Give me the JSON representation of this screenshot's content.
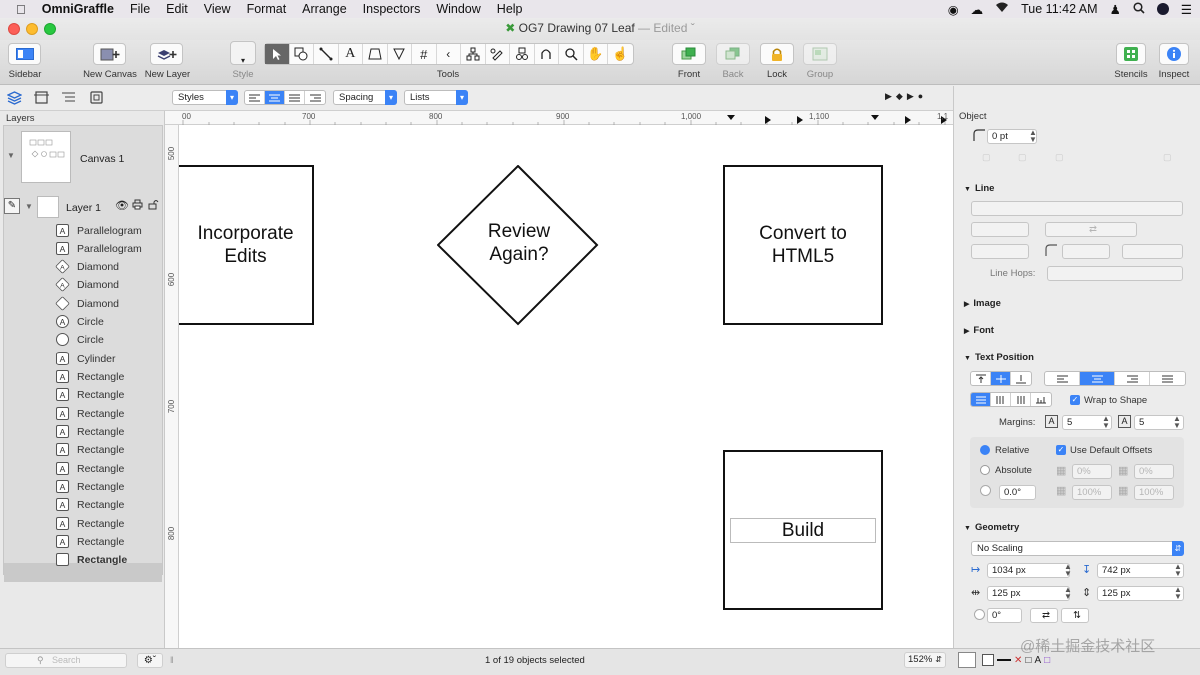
{
  "menubar": {
    "app_name": "OmniGraffle",
    "items": [
      "File",
      "Edit",
      "View",
      "Format",
      "Arrange",
      "Inspectors",
      "Window",
      "Help"
    ],
    "clock": "Tue 11:42 AM"
  },
  "window": {
    "title": "OG7 Drawing 07 Leaf",
    "edited": "— Edited"
  },
  "toolbar": {
    "sidebar": "Sidebar",
    "new_canvas": "New Canvas",
    "new_layer": "New Layer",
    "style": "Style",
    "tools": "Tools",
    "front": "Front",
    "back": "Back",
    "lock": "Lock",
    "group": "Group",
    "stencils": "Stencils",
    "inspect": "Inspect"
  },
  "subbar": {
    "styles": "Styles",
    "spacing": "Spacing",
    "lists": "Lists"
  },
  "sidebar": {
    "layers_header": "Layers",
    "canvas_name": "Canvas 1",
    "layer_name": "Layer 1",
    "items": [
      {
        "label": "Parallelogram",
        "glyph": "A"
      },
      {
        "label": "Parallelogram",
        "glyph": "A"
      },
      {
        "label": "Diamond",
        "glyph": "A"
      },
      {
        "label": "Diamond",
        "glyph": "A"
      },
      {
        "label": "Diamond",
        "glyph": ""
      },
      {
        "label": "Circle",
        "glyph": "A"
      },
      {
        "label": "Circle",
        "glyph": ""
      },
      {
        "label": "Cylinder",
        "glyph": "A"
      },
      {
        "label": "Rectangle",
        "glyph": "A"
      },
      {
        "label": "Rectangle",
        "glyph": "A"
      },
      {
        "label": "Rectangle",
        "glyph": "A"
      },
      {
        "label": "Rectangle",
        "glyph": "A"
      },
      {
        "label": "Rectangle",
        "glyph": "A"
      },
      {
        "label": "Rectangle",
        "glyph": "A"
      },
      {
        "label": "Rectangle",
        "glyph": "A"
      },
      {
        "label": "Rectangle",
        "glyph": "A"
      },
      {
        "label": "Rectangle",
        "glyph": "A"
      },
      {
        "label": "Rectangle",
        "glyph": "A"
      },
      {
        "label": "Rectangle",
        "glyph": ""
      }
    ],
    "search_placeholder": "Search"
  },
  "ruler": {
    "h_ticks": [
      "00",
      "700",
      "800",
      "900",
      "1,000",
      "1,100",
      "1,1"
    ],
    "v_ticks": [
      "500",
      "600",
      "700",
      "800"
    ]
  },
  "canvas": {
    "shapes": {
      "incorporate": "Incorporate\nEdits",
      "review": "Review\nAgain?",
      "convert": "Convert to\nHTML5",
      "build": "Build"
    }
  },
  "inspector": {
    "object_label": "Object",
    "corner_value": "0 pt",
    "line_header": "Line",
    "line_hops": "Line Hops:",
    "image_header": "Image",
    "font_header": "Font",
    "text_position_header": "Text Position",
    "wrap_to_shape": "Wrap to Shape",
    "margins_label": "Margins:",
    "margin_left": "5",
    "margin_right": "5",
    "relative": "Relative",
    "absolute": "Absolute",
    "use_default_offsets": "Use Default Offsets",
    "pct0a": "0%",
    "pct0b": "0%",
    "pct100a": "100%",
    "pct100b": "100%",
    "rotation": "0.0°",
    "geometry_header": "Geometry",
    "scaling": "No Scaling",
    "x": "1034 px",
    "y": "742 px",
    "width": "125 px",
    "height": "125 px",
    "angle": "0°"
  },
  "status": {
    "selection": "1 of 19 objects selected",
    "zoom": "152%"
  },
  "watermark": "@稀土掘金技术社区"
}
